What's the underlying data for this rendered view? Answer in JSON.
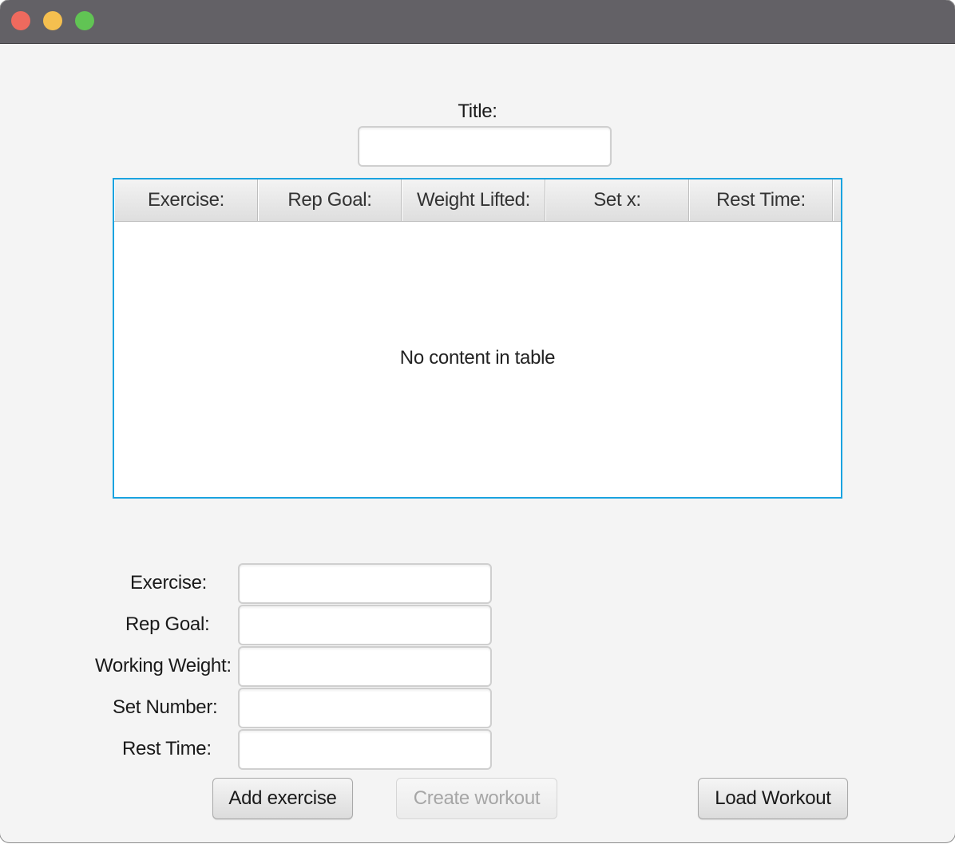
{
  "window": {
    "controls": {
      "close_color": "#ee6a5e",
      "minimize_color": "#f5bf4f",
      "maximize_color": "#61c454"
    }
  },
  "title_section": {
    "label": "Title:",
    "value": ""
  },
  "table": {
    "columns": [
      "Exercise:",
      "Rep Goal:",
      "Weight Lifted:",
      "Set x:",
      "Rest Time:"
    ],
    "empty_message": "No content in table",
    "focus_border_color": "#1aa3e0"
  },
  "form": {
    "exercise": {
      "label": "Exercise:",
      "value": ""
    },
    "rep_goal": {
      "label": "Rep Goal:",
      "value": ""
    },
    "working_weight": {
      "label": "Working Weight:",
      "value": ""
    },
    "set_number": {
      "label": "Set Number:",
      "value": ""
    },
    "rest_time": {
      "label": "Rest Time:",
      "value": ""
    }
  },
  "buttons": {
    "add_exercise": "Add exercise",
    "create_workout": "Create workout",
    "load_workout": "Load Workout"
  }
}
